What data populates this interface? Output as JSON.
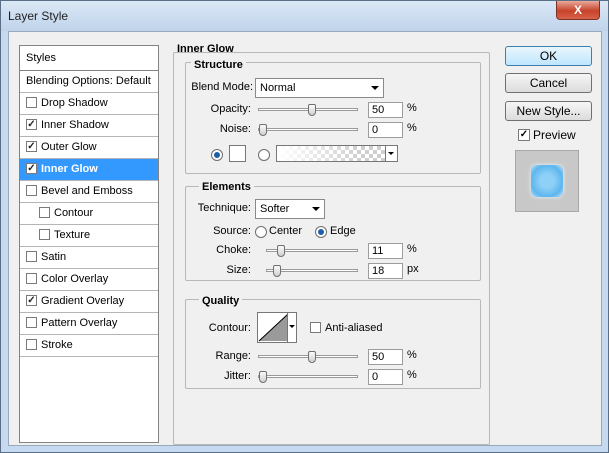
{
  "window": {
    "title": "Layer Style",
    "close_label": "X"
  },
  "styles_panel": {
    "header": "Styles",
    "blending_options": "Blending Options: Default",
    "items": [
      {
        "label": "Drop Shadow",
        "checked": false
      },
      {
        "label": "Inner Shadow",
        "checked": true
      },
      {
        "label": "Outer Glow",
        "checked": true
      },
      {
        "label": "Inner Glow",
        "checked": true,
        "selected": true
      },
      {
        "label": "Bevel and Emboss",
        "checked": false
      },
      {
        "label": "Contour",
        "checked": false,
        "indent": true
      },
      {
        "label": "Texture",
        "checked": false,
        "indent": true
      },
      {
        "label": "Satin",
        "checked": false
      },
      {
        "label": "Color Overlay",
        "checked": false
      },
      {
        "label": "Gradient Overlay",
        "checked": true
      },
      {
        "label": "Pattern Overlay",
        "checked": false
      },
      {
        "label": "Stroke",
        "checked": false
      }
    ],
    "check_glyph": "✓"
  },
  "inner_glow": {
    "title": "Inner Glow",
    "structure": {
      "title": "Structure",
      "blend_mode_label": "Blend Mode:",
      "blend_mode_value": "Normal",
      "opacity_label": "Opacity:",
      "opacity_value": "50",
      "opacity_fraction": 0.5,
      "noise_label": "Noise:",
      "noise_value": "0",
      "noise_fraction": 0.0,
      "percent": "%",
      "glow_color": "#ffffff"
    },
    "elements": {
      "title": "Elements",
      "technique_label": "Technique:",
      "technique_value": "Softer",
      "source_label": "Source:",
      "source_center": "Center",
      "source_edge": "Edge",
      "choke_label": "Choke:",
      "choke_value": "11",
      "choke_fraction": 0.11,
      "size_label": "Size:",
      "size_value": "18",
      "size_fraction": 0.072,
      "percent": "%",
      "px": "px"
    },
    "quality": {
      "title": "Quality",
      "contour_label": "Contour:",
      "anti_aliased_label": "Anti-aliased",
      "range_label": "Range:",
      "range_value": "50",
      "range_fraction": 0.5,
      "jitter_label": "Jitter:",
      "jitter_value": "0",
      "jitter_fraction": 0.0,
      "percent": "%"
    }
  },
  "actions": {
    "ok": "OK",
    "cancel": "Cancel",
    "new_style": "New Style...",
    "preview_label": "Preview",
    "preview_checked": true
  }
}
